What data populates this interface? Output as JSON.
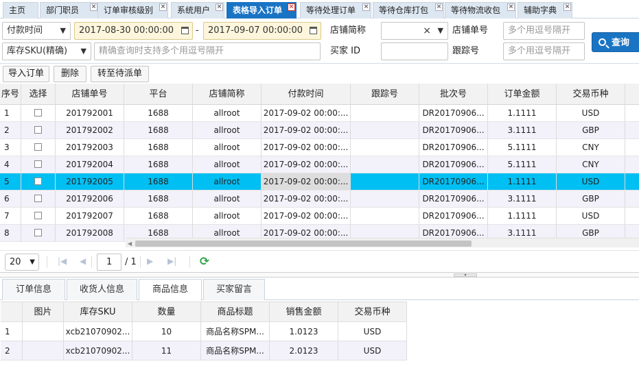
{
  "tabs": [
    {
      "label": "主页",
      "closable": false
    },
    {
      "label": "部门职员",
      "closable": true
    },
    {
      "label": "订单审核级别",
      "closable": true
    },
    {
      "label": "系统用户",
      "closable": true
    },
    {
      "label": "表格导入订单",
      "closable": true,
      "active": true
    },
    {
      "label": "等待处理订单",
      "closable": true
    },
    {
      "label": "等待仓库打包",
      "closable": true
    },
    {
      "label": "等待物流收包",
      "closable": true
    },
    {
      "label": "辅助字典",
      "closable": true
    }
  ],
  "filters": {
    "time_type": "付款时间",
    "date_from": "2017-08-30 00:00:00",
    "date_to": "2017-09-07 00:00:00",
    "date_sep": "-",
    "shop_label": "店铺简称",
    "shop_value": "",
    "shop_clear": "×",
    "order_no_label": "店铺单号",
    "order_no_placeholder": "多个用逗号隔开",
    "sku_type": "库存SKU(精确)",
    "sku_placeholder": "精确查询时支持多个用逗号隔开",
    "buyer_label": "买家 ID",
    "buyer_value": "",
    "track_label": "跟踪号",
    "track_placeholder": "多个用逗号隔开",
    "search_label": "查询"
  },
  "toolbar": {
    "import_label": "导入订单",
    "delete_label": "删除",
    "dispatch_label": "转至待派单"
  },
  "grid": {
    "headers": [
      "序号",
      "选择",
      "店铺单号",
      "平台",
      "店铺简称",
      "付款时间",
      "跟踪号",
      "批次号",
      "订单金额",
      "交易币种"
    ],
    "rows": [
      {
        "no": "1",
        "order": "201792001",
        "platform": "1688",
        "shop": "allroot",
        "paid": "2017-09-02 00:00:...",
        "track": "",
        "batch": "DR20170906...",
        "amount": "1.1111",
        "currency": "USD"
      },
      {
        "no": "2",
        "order": "201792002",
        "platform": "1688",
        "shop": "allroot",
        "paid": "2017-09-02 00:00:...",
        "track": "",
        "batch": "DR20170906...",
        "amount": "3.1111",
        "currency": "GBP"
      },
      {
        "no": "3",
        "order": "201792003",
        "platform": "1688",
        "shop": "allroot",
        "paid": "2017-09-02 00:00:...",
        "track": "",
        "batch": "DR20170906...",
        "amount": "5.1111",
        "currency": "CNY"
      },
      {
        "no": "4",
        "order": "201792004",
        "platform": "1688",
        "shop": "allroot",
        "paid": "2017-09-02 00:00:...",
        "track": "",
        "batch": "DR20170906...",
        "amount": "5.1111",
        "currency": "CNY"
      },
      {
        "no": "5",
        "order": "201792005",
        "platform": "1688",
        "shop": "allroot",
        "paid": "2017-09-02 00:00:...",
        "track": "",
        "batch": "DR20170906...",
        "amount": "1.1111",
        "currency": "USD"
      },
      {
        "no": "6",
        "order": "201792006",
        "platform": "1688",
        "shop": "allroot",
        "paid": "2017-09-02 00:00:...",
        "track": "",
        "batch": "DR20170906...",
        "amount": "3.1111",
        "currency": "GBP"
      },
      {
        "no": "7",
        "order": "201792007",
        "platform": "1688",
        "shop": "allroot",
        "paid": "2017-09-02 00:00:...",
        "track": "",
        "batch": "DR20170906...",
        "amount": "1.1111",
        "currency": "USD"
      },
      {
        "no": "8",
        "order": "201792008",
        "platform": "1688",
        "shop": "allroot",
        "paid": "2017-09-02 00:00:...",
        "track": "",
        "batch": "DR20170906...",
        "amount": "3.1111",
        "currency": "GBP"
      }
    ]
  },
  "pager": {
    "page_size": "20",
    "page": "1",
    "total": "/ 1"
  },
  "detail_tabs": [
    "订单信息",
    "收货人信息",
    "商品信息",
    "买家留言"
  ],
  "detail_grid": {
    "headers": [
      "",
      "图片",
      "库存SKU",
      "数量",
      "商品标题",
      "销售金额",
      "交易币种"
    ],
    "rows": [
      {
        "no": "1",
        "image": "",
        "sku": "xcb21070902...",
        "qty": "10",
        "title": "商品名称SPM...",
        "amount": "1.0123",
        "currency": "USD"
      },
      {
        "no": "2",
        "image": "",
        "sku": "xcb21070902...",
        "qty": "11",
        "title": "商品名称SPM...",
        "amount": "2.0123",
        "currency": "USD"
      }
    ]
  },
  "colors": {
    "accent": "#1a74c4",
    "selected_row": "#00bff3",
    "date_bg": "#fdf6dc"
  }
}
